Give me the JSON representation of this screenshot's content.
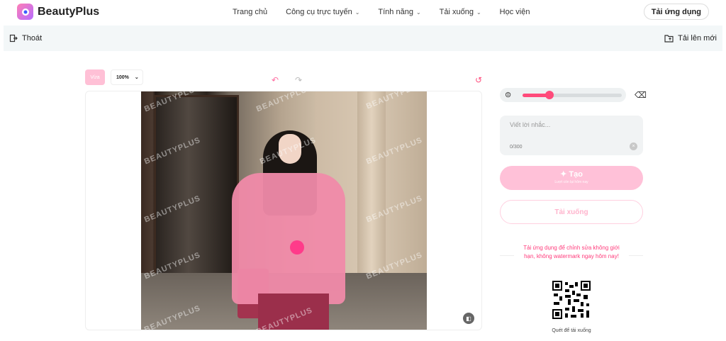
{
  "brand": {
    "name": "BeautyPlus"
  },
  "nav": [
    {
      "label": "Trang chủ",
      "caret": false
    },
    {
      "label": "Công cụ trực tuyến",
      "caret": true
    },
    {
      "label": "Tính năng",
      "caret": true
    },
    {
      "label": "Tải xuống",
      "caret": true
    },
    {
      "label": "Học viện",
      "caret": false
    }
  ],
  "header": {
    "app_button": "Tải ứng dụng"
  },
  "subbar": {
    "exit_label": "Thoát",
    "upload_label": "Tải lên mới"
  },
  "toolbar": {
    "fit_label": "Vừa",
    "zoom": "100%"
  },
  "canvas": {
    "watermark": "BEAUTYPLUS"
  },
  "panel": {
    "brush_size_fraction": 0.27,
    "prompt_placeholder": "Viết lời nhắc...",
    "char_count": "0/300",
    "generate_label": "Tạo",
    "generate_sub": "Lượt còn lại hôm nay",
    "download_label": "Tải xuống",
    "promo_text": "Tải ứng dụng để chỉnh sửa không giới hạn, không watermark ngay hôm nay!",
    "qr_caption": "Quét để tải xuống"
  },
  "colors": {
    "accent": "#ff4b7b",
    "accent_light": "#ffc1d8"
  }
}
